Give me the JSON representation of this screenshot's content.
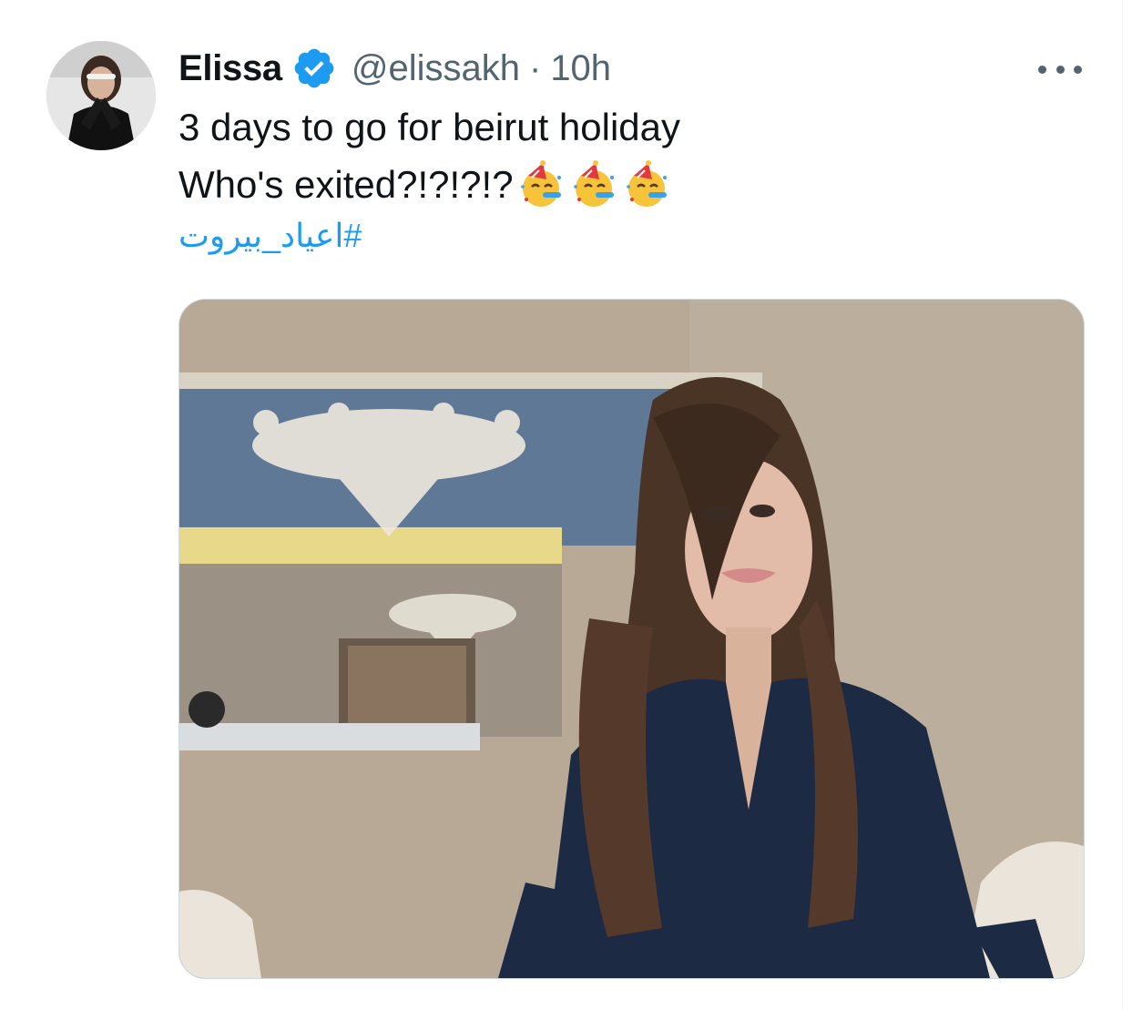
{
  "author": {
    "display_name": "Elissa",
    "handle": "@elissakh",
    "separator": "·",
    "timestamp": "10h",
    "verified": true
  },
  "tweet": {
    "line1": "3 days to go for beirut holiday",
    "line2": "Who's exited?!?!?!?",
    "emoji": [
      "partying-face",
      "partying-face",
      "partying-face"
    ],
    "hashtag": "#اعياد_بيروت"
  },
  "icons": {
    "verified_badge": "verified-badge-icon",
    "more": "more-options-icon"
  },
  "colors": {
    "text_primary": "#0f1419",
    "text_secondary": "#536471",
    "link": "#1d9bf0",
    "verified": "#1d9bf0",
    "border": "#cfd9de"
  }
}
